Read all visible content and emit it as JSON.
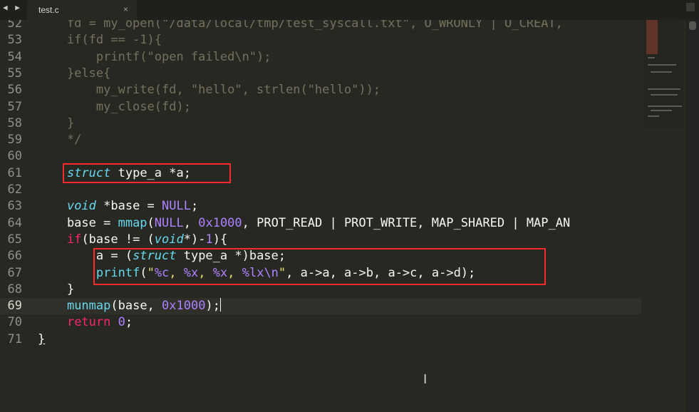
{
  "tab": {
    "title": "test.c",
    "close": "×",
    "nav": "◀ ▶"
  },
  "lines": [
    {
      "no": "52",
      "parts": [
        [
          "cm",
          "    fd = my_open(\"/data/local/tmp/test_syscall.txt\", O_WRONLY | O_CREAT,"
        ]
      ]
    },
    {
      "no": "53",
      "parts": [
        [
          "cm",
          "    if(fd == -1){"
        ]
      ]
    },
    {
      "no": "54",
      "parts": [
        [
          "cm",
          "        printf(\"open failed\\n\");"
        ]
      ]
    },
    {
      "no": "55",
      "parts": [
        [
          "cm",
          "    }else{"
        ]
      ]
    },
    {
      "no": "56",
      "parts": [
        [
          "cm",
          "        my_write(fd, \"hello\", strlen(\"hello\"));"
        ]
      ]
    },
    {
      "no": "57",
      "parts": [
        [
          "cm",
          "        my_close(fd);"
        ]
      ]
    },
    {
      "no": "58",
      "parts": [
        [
          "cm",
          "    }"
        ]
      ]
    },
    {
      "no": "59",
      "parts": [
        [
          "cm",
          "    */"
        ]
      ]
    },
    {
      "no": "60",
      "parts": []
    },
    {
      "no": "61",
      "parts": [
        [
          "",
          "    "
        ],
        [
          "st",
          "struct"
        ],
        [
          "",
          " type_a *a;"
        ]
      ]
    },
    {
      "no": "62",
      "parts": []
    },
    {
      "no": "63",
      "parts": [
        [
          "",
          "    "
        ],
        [
          "st",
          "void"
        ],
        [
          "",
          " *base = "
        ],
        [
          "nm",
          "NULL"
        ],
        [
          "",
          ";"
        ]
      ]
    },
    {
      "no": "64",
      "parts": [
        [
          "",
          "    base = "
        ],
        [
          "fn",
          "mmap"
        ],
        [
          "",
          "("
        ],
        [
          "nm",
          "NULL"
        ],
        [
          "",
          ", "
        ],
        [
          "nm",
          "0x1000"
        ],
        [
          "",
          ", PROT_READ | PROT_WRITE, MAP_SHARED | MAP_AN"
        ]
      ]
    },
    {
      "no": "65",
      "parts": [
        [
          "",
          "    "
        ],
        [
          "kw",
          "if"
        ],
        [
          "",
          "(base != ("
        ],
        [
          "st",
          "void"
        ],
        [
          "",
          "*)-"
        ],
        [
          "nm",
          "1"
        ],
        [
          "",
          "){"
        ]
      ]
    },
    {
      "no": "66",
      "parts": [
        [
          "",
          "        a = ("
        ],
        [
          "st",
          "struct"
        ],
        [
          "",
          " type_a *)base;"
        ]
      ]
    },
    {
      "no": "67",
      "parts": [
        [
          "",
          "        "
        ],
        [
          "fn",
          "printf"
        ],
        [
          "",
          "("
        ],
        [
          "sr",
          "\""
        ],
        [
          "fx",
          "%c"
        ],
        [
          "sr",
          ", "
        ],
        [
          "fx",
          "%x"
        ],
        [
          "sr",
          ", "
        ],
        [
          "fx",
          "%x"
        ],
        [
          "sr",
          ", "
        ],
        [
          "fx",
          "%lx"
        ],
        [
          "fx",
          "\\n"
        ],
        [
          "sr",
          "\""
        ],
        [
          "",
          ", a->a, a->b, a->c, a->d);"
        ]
      ]
    },
    {
      "no": "68",
      "parts": [
        [
          "",
          "    }"
        ]
      ]
    },
    {
      "no": "69",
      "parts": [
        [
          "",
          "    "
        ],
        [
          "fn",
          "munmap"
        ],
        [
          "",
          "(base, "
        ],
        [
          "nm",
          "0x1000"
        ],
        [
          "",
          ");"
        ]
      ],
      "current": true,
      "cursor": true
    },
    {
      "no": "70",
      "parts": [
        [
          "",
          "    "
        ],
        [
          "kw",
          "return"
        ],
        [
          "",
          " "
        ],
        [
          "nm",
          "0"
        ],
        [
          "",
          ";"
        ]
      ]
    },
    {
      "no": "71",
      "parts": [
        [
          "ul",
          "}"
        ]
      ]
    }
  ]
}
